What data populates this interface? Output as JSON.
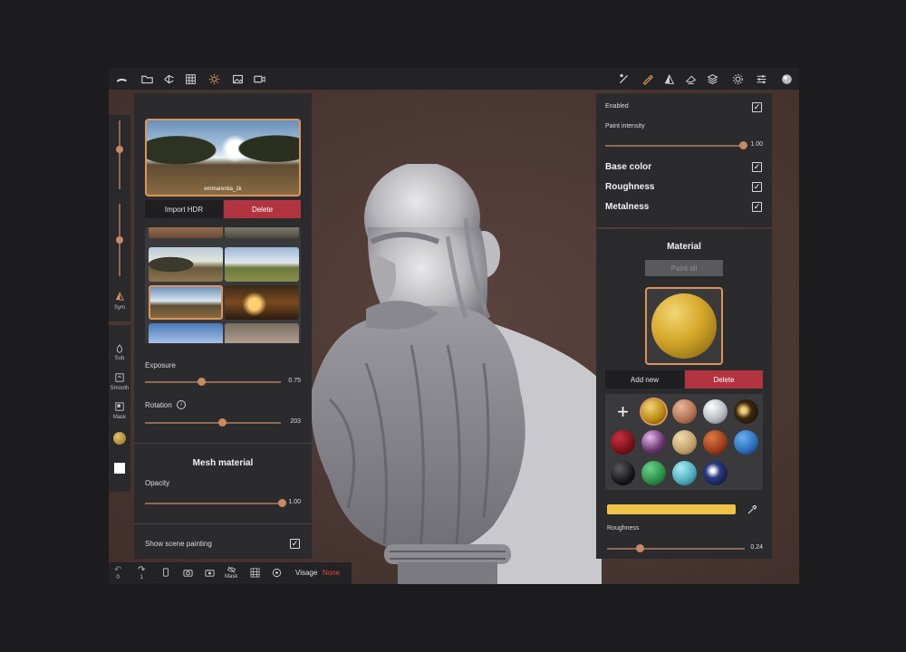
{
  "topbar": {
    "left_icons": [
      "home-icon",
      "folder-icon",
      "scene-tree-icon",
      "grid-icon",
      "sun-icon",
      "image-icon",
      "camera-icon"
    ],
    "right_icons": [
      "brush-icon",
      "paint-icon",
      "symmetry-icon",
      "select-icon",
      "layers-icon",
      "settings-icon",
      "sliders-icon",
      "matcap-icon"
    ]
  },
  "left_strip": {
    "sym_label": "Sym",
    "sub_label": "Sub",
    "smooth_label": "Smooth",
    "mask_label": "Mask"
  },
  "environment": {
    "hdr_name": "emmarentia_1k",
    "import_label": "Import HDR",
    "delete_label": "Delete",
    "exposure_label": "Exposure",
    "exposure_value": "0.75",
    "rotation_label": "Rotation",
    "rotation_info": "i",
    "rotation_value": "203"
  },
  "mesh_material": {
    "title": "Mesh material",
    "opacity_label": "Opacity",
    "opacity_value": "1.00",
    "show_scene_painting_label": "Show scene painting"
  },
  "bottombar": {
    "undo_count": "0",
    "redo_count": "1",
    "mask_label": "Mask",
    "visage_label": "Visage",
    "visage_value": "None"
  },
  "painting": {
    "enabled_label": "Enabled",
    "paint_intensity_label": "Paint intensity",
    "paint_intensity_value": "1.00",
    "base_color_label": "Base color",
    "roughness_label": "Roughness",
    "metalness_label": "Metalness"
  },
  "material": {
    "title": "Material",
    "paint_all_label": "Paint all",
    "add_new_label": "Add new",
    "delete_label": "Delete",
    "add_symbol": "+",
    "roughness_label": "Roughness",
    "roughness_value": "0.24",
    "color_swatch": "#efc24a"
  },
  "colors": {
    "accent": "#d9955b",
    "danger": "#b23440",
    "panel": "#2b2b2d",
    "background": "#4a3733",
    "visage_none": "#e0453e"
  }
}
